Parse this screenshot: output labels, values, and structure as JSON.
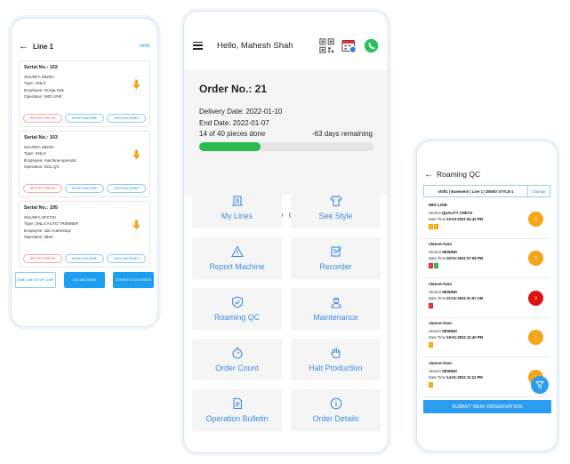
{
  "colors": {
    "accent": "#3d8de0",
    "progress": "#2dbb4e",
    "warning": "#f5a515",
    "danger": "#e01010",
    "primary_button": "#2b9cef"
  },
  "line_screen": {
    "title": "Line 1",
    "shift": "shift1",
    "cards": [
      {
        "serial": "Serial No.: 102",
        "model": "SHUNFA S620H",
        "type": "Type: SNLS",
        "employee": "Employee: Durga Das",
        "operation": "Operation: MID LINE"
      },
      {
        "serial": "Serial No.: 103",
        "model": "SHUNFA S620H",
        "type": "Type: SNLS",
        "employee": "Employee: machine-operator",
        "operation": "Operation: EOL QC"
      },
      {
        "serial": "Serial No.: 195",
        "model": "SHUNFA SF272II",
        "type": "Type: DNLS AUTO TRIMMER",
        "employee": "Employee: abc-maheshqc",
        "operation": "Operation: label"
      }
    ],
    "card_buttons": {
      "report": "REPORT ERROR",
      "move": "MOVE MACHINE",
      "view": "VIEW MACHINES"
    },
    "footer_buttons": {
      "same_line": "SAME LINE SETUP COMP.",
      "add": "ADD MACHINES",
      "complete": "COMPLETE LINE ORDER"
    }
  },
  "home_screen": {
    "greeting": "Hello, Mahesh Shah",
    "icons": {
      "menu": "hamburger-icon",
      "qr": "qr-code-icon",
      "calendar": "calendar-settings-icon",
      "whatsapp": "whatsapp-icon"
    },
    "order_no": "Order No.: 21",
    "delivery_date": "Delivery Date: 2022-01-10",
    "end_date": "End Date: 2022-01-07",
    "pieces_done": "14 of 40 pieces done",
    "days_remaining": "-63 days remaining",
    "progress_fraction": 0.35,
    "pager": {
      "count": 16,
      "active": 9
    },
    "tiles": [
      {
        "label": "My Lines",
        "icon": "machine-icon"
      },
      {
        "label": "See Style",
        "icon": "shirt-icon"
      },
      {
        "label": "Report Machine",
        "icon": "warning-icon"
      },
      {
        "label": "Recorder",
        "icon": "edit-icon"
      },
      {
        "label": "Roaming QC",
        "icon": "shield-check-icon"
      },
      {
        "label": "Maintenance",
        "icon": "engineer-icon"
      },
      {
        "label": "Order Count",
        "icon": "timer-icon"
      },
      {
        "label": "Halt Production",
        "icon": "hand-stop-icon"
      },
      {
        "label": "Operation Bulletin",
        "icon": "document-icon"
      },
      {
        "label": "Order Details",
        "icon": "info-icon"
      }
    ]
  },
  "qc_screen": {
    "title": "Roaming QC",
    "filter": "shift1 | Basement | Line 1 | DEMO STYLE-1",
    "change": "Change",
    "section_label": "Section:",
    "datetime_label": "Date Time:",
    "observations": [
      {
        "title": "MID LINE",
        "section": "QUALITY CHECK",
        "datetime": "10-03-2022 04:43 PM",
        "tags": [
          {
            "t": "1",
            "c": "y"
          },
          {
            "t": "1",
            "c": "y"
          }
        ],
        "badge": "0",
        "badge_color": "y"
      },
      {
        "title": "sleeve-hem",
        "section": "SEWING",
        "datetime": "30-01-2022 07:08 PM",
        "tags": [
          {
            "t": "2",
            "c": "r"
          },
          {
            "t": "1",
            "c": "g"
          }
        ],
        "badge": "0",
        "badge_color": "y"
      },
      {
        "title": "sleeve-hem",
        "section": "SEWING",
        "datetime": "21-01-2022 01:57 AM",
        "tags": [
          {
            "t": "1",
            "c": "r"
          }
        ],
        "badge": "3",
        "badge_color": "r"
      },
      {
        "title": "sleeve-hem",
        "section": "SEWING",
        "datetime": "19-01-2022 12:40 PM",
        "tags": [
          {
            "t": "1",
            "c": "y"
          }
        ],
        "badge": "1",
        "badge_color": "y"
      },
      {
        "title": "sleeve-hem",
        "section": "SEWING",
        "datetime": "14-01-2022 11:21 PM",
        "tags": [
          {
            "t": "1",
            "c": "y"
          }
        ],
        "badge": "1",
        "badge_color": "y"
      }
    ],
    "submit": "SUBMIT NEW OBSERVATION",
    "fab_icon": "filter-icon"
  }
}
